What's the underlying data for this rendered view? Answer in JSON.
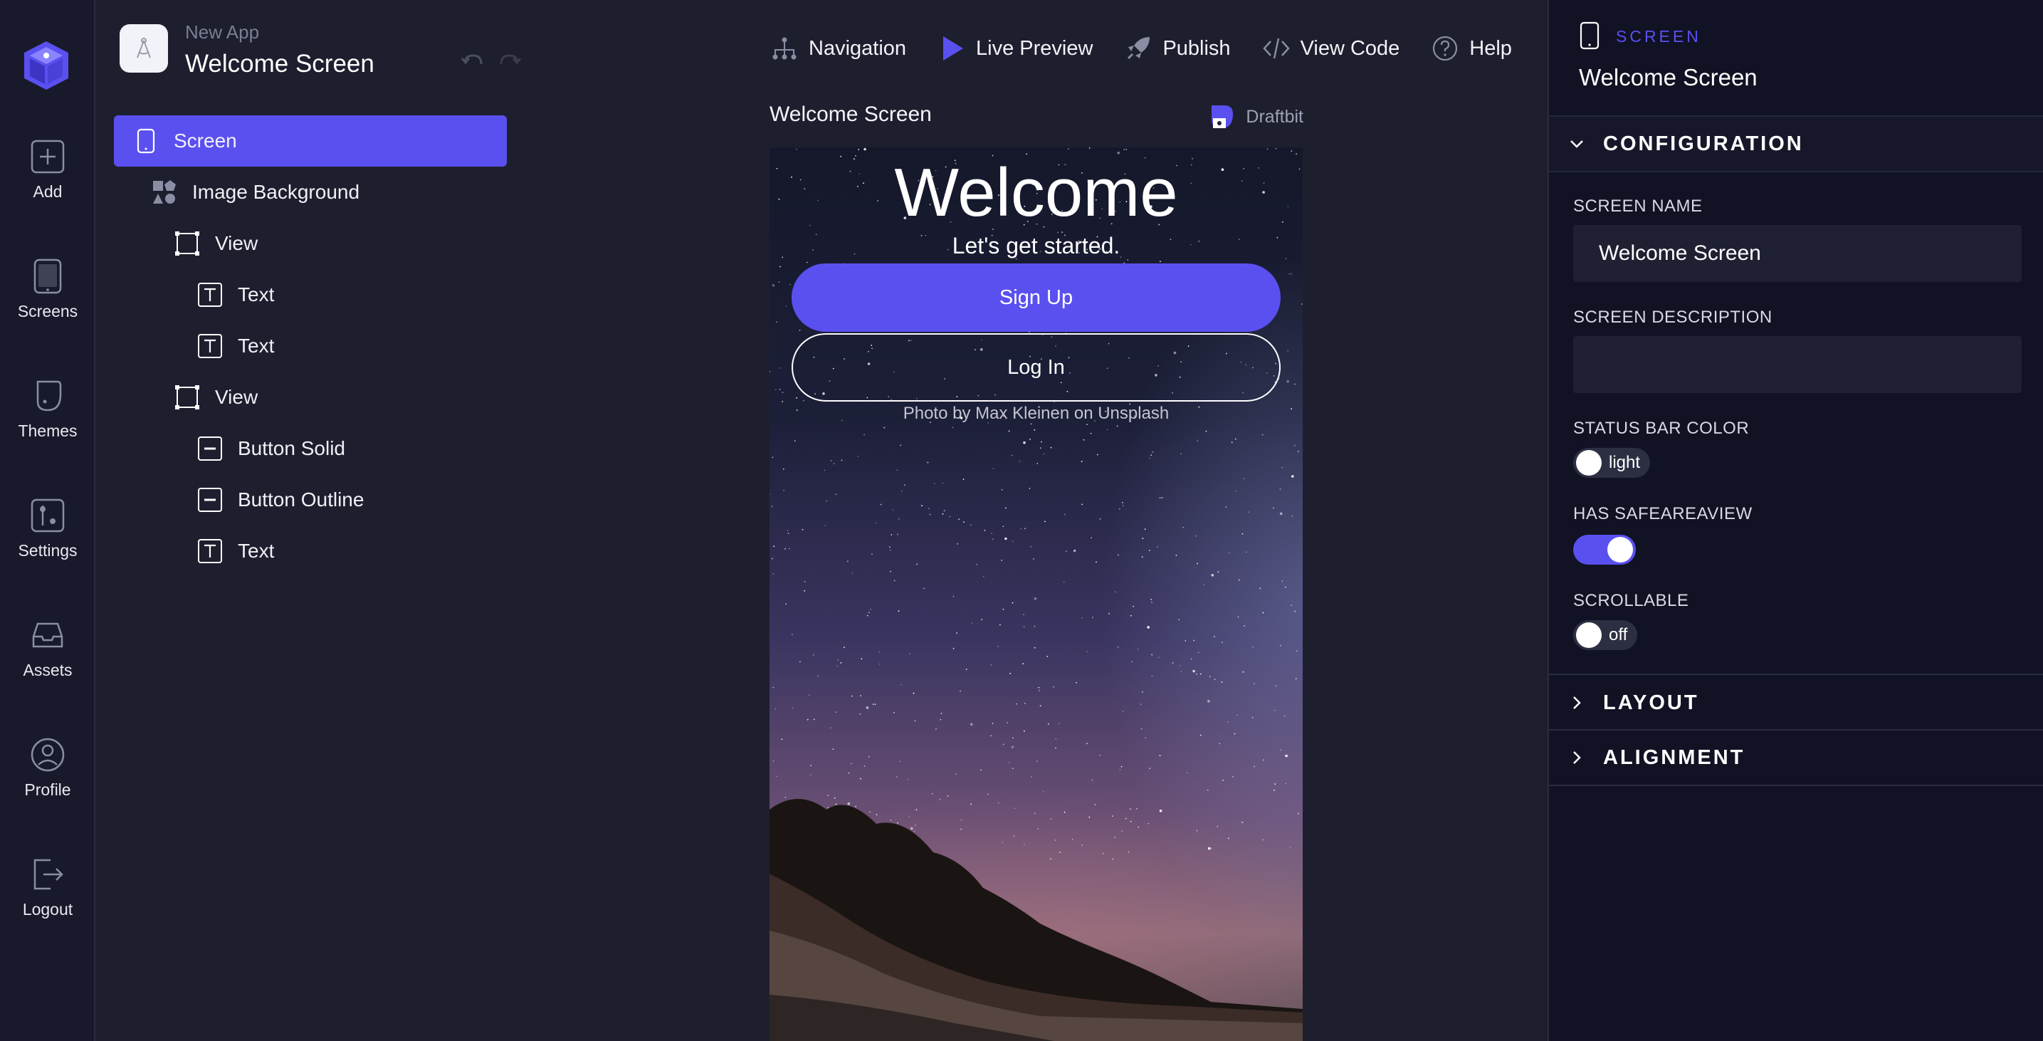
{
  "app": {
    "subtitle": "New App",
    "title": "Welcome Screen"
  },
  "rail": {
    "items": [
      {
        "label": "Add",
        "icon": "plus-square-icon"
      },
      {
        "label": "Screens",
        "icon": "tablet-icon"
      },
      {
        "label": "Themes",
        "icon": "paint-bucket-icon"
      },
      {
        "label": "Settings",
        "icon": "sliders-icon"
      },
      {
        "label": "Assets",
        "icon": "inbox-tray-icon"
      },
      {
        "label": "Profile",
        "icon": "user-circle-icon"
      },
      {
        "label": "Logout",
        "icon": "logout-arrow-icon"
      }
    ]
  },
  "tree": {
    "items": [
      {
        "label": "Screen",
        "icon": "tablet-icon",
        "depth": 0,
        "selected": true
      },
      {
        "label": "Image Background",
        "icon": "shapes-icon",
        "depth": 1
      },
      {
        "label": "View",
        "icon": "view-frame-icon",
        "depth": 2
      },
      {
        "label": "Text",
        "icon": "text-icon",
        "depth": 3
      },
      {
        "label": "Text",
        "icon": "text-icon",
        "depth": 3
      },
      {
        "label": "View",
        "icon": "view-frame-icon",
        "depth": 2
      },
      {
        "label": "Button Solid",
        "icon": "button-icon",
        "depth": 3
      },
      {
        "label": "Button Outline",
        "icon": "button-icon",
        "depth": 3
      },
      {
        "label": "Text",
        "icon": "text-icon",
        "depth": 3
      }
    ]
  },
  "toolbar": {
    "navigation": "Navigation",
    "live_preview": "Live Preview",
    "publish": "Publish",
    "view_code": "View Code",
    "help": "Help"
  },
  "canvas": {
    "screen_title": "Welcome Screen",
    "brand": "Draftbit"
  },
  "preview": {
    "heading": "Welcome",
    "subheading": "Let's get started.",
    "signup_label": "Sign Up",
    "login_label": "Log In",
    "credit": "Photo by Max Kleinen on Unsplash"
  },
  "props": {
    "kind": "SCREEN",
    "title": "Welcome Screen",
    "configuration_label": "CONFIGURATION",
    "layout_label": "LAYOUT",
    "alignment_label": "ALIGNMENT",
    "screen_name_label": "SCREEN NAME",
    "screen_name_value": "Welcome Screen",
    "screen_description_label": "SCREEN DESCRIPTION",
    "screen_description_value": "",
    "status_bar_label": "STATUS BAR COLOR",
    "status_bar_value": "light",
    "safeareaview_label": "HAS SAFEAREAVIEW",
    "safeareaview_on": true,
    "scrollable_label": "SCROLLABLE",
    "scrollable_value": "off"
  },
  "colors": {
    "accent": "#5a50f0",
    "rail_bg": "#181a2b",
    "panel_bg": "#1e1f2e",
    "props_bg": "#111223"
  }
}
